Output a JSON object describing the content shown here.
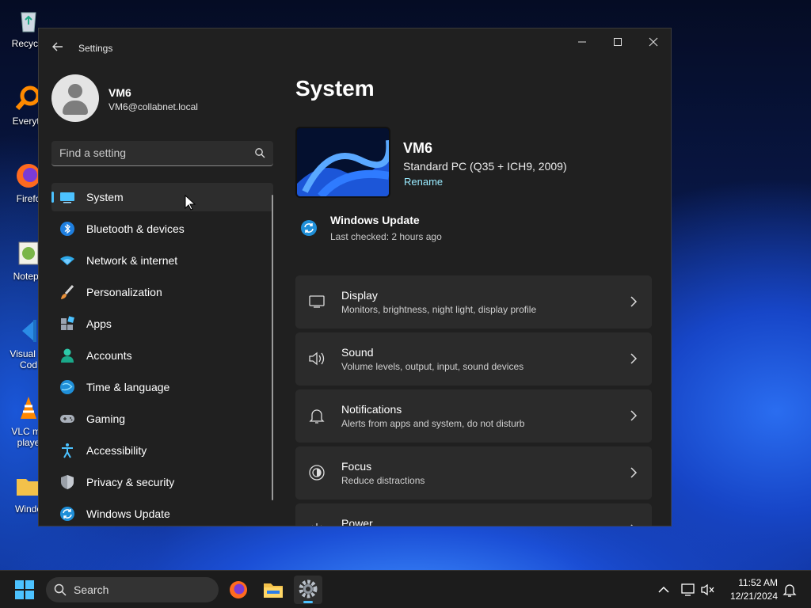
{
  "desktop": {
    "icons": [
      {
        "label": "Recycle",
        "icon": "recycle-bin-icon"
      },
      {
        "label": "Everyth",
        "icon": "everything-search-icon"
      },
      {
        "label": "Firefo",
        "icon": "firefox-icon"
      },
      {
        "label": "Notepa",
        "icon": "notepad-plus-plus-icon"
      },
      {
        "label": "Visual St Cod",
        "icon": "vscode-icon"
      },
      {
        "label": "VLC me playe",
        "icon": "vlc-icon"
      },
      {
        "label": "Windo",
        "icon": "folder-icon"
      }
    ]
  },
  "window": {
    "title": "Settings",
    "controls": {
      "minimize": "—",
      "maximize": "☐",
      "close": "✕"
    }
  },
  "profile": {
    "name": "VM6",
    "email": "VM6@collabnet.local"
  },
  "search": {
    "placeholder": "Find a setting"
  },
  "nav": {
    "items": [
      {
        "label": "System",
        "icon": "system-display-icon",
        "selected": true
      },
      {
        "label": "Bluetooth & devices",
        "icon": "bluetooth-icon"
      },
      {
        "label": "Network & internet",
        "icon": "wifi-icon"
      },
      {
        "label": "Personalization",
        "icon": "paintbrush-icon"
      },
      {
        "label": "Apps",
        "icon": "apps-icon"
      },
      {
        "label": "Accounts",
        "icon": "accounts-icon"
      },
      {
        "label": "Time & language",
        "icon": "globe-clock-icon"
      },
      {
        "label": "Gaming",
        "icon": "gamepad-icon"
      },
      {
        "label": "Accessibility",
        "icon": "accessibility-icon"
      },
      {
        "label": "Privacy & security",
        "icon": "shield-icon"
      },
      {
        "label": "Windows Update",
        "icon": "windows-update-icon"
      }
    ]
  },
  "main": {
    "title": "System",
    "device": {
      "name": "VM6",
      "model": "Standard PC (Q35 + ICH9, 2009)",
      "rename_label": "Rename"
    },
    "windows_update": {
      "title": "Windows Update",
      "status": "Last checked: 2 hours ago"
    },
    "cards": [
      {
        "title": "Display",
        "subtitle": "Monitors, brightness, night light, display profile",
        "icon": "monitor-icon"
      },
      {
        "title": "Sound",
        "subtitle": "Volume levels, output, input, sound devices",
        "icon": "speaker-icon"
      },
      {
        "title": "Notifications",
        "subtitle": "Alerts from apps and system, do not disturb",
        "icon": "bell-icon"
      },
      {
        "title": "Focus",
        "subtitle": "Reduce distractions",
        "icon": "focus-icon"
      },
      {
        "title": "Power",
        "subtitle": "",
        "icon": "power-icon"
      }
    ]
  },
  "taskbar": {
    "search_label": "Search",
    "time": "11:52 AM",
    "date": "12/21/2024",
    "apps": [
      "firefox-icon",
      "file-explorer-icon",
      "settings-gear-icon"
    ]
  },
  "colors": {
    "accent": "#4cc2ff",
    "link": "#99ebff",
    "window_bg": "#202020",
    "card_bg": "#2b2b2b"
  }
}
